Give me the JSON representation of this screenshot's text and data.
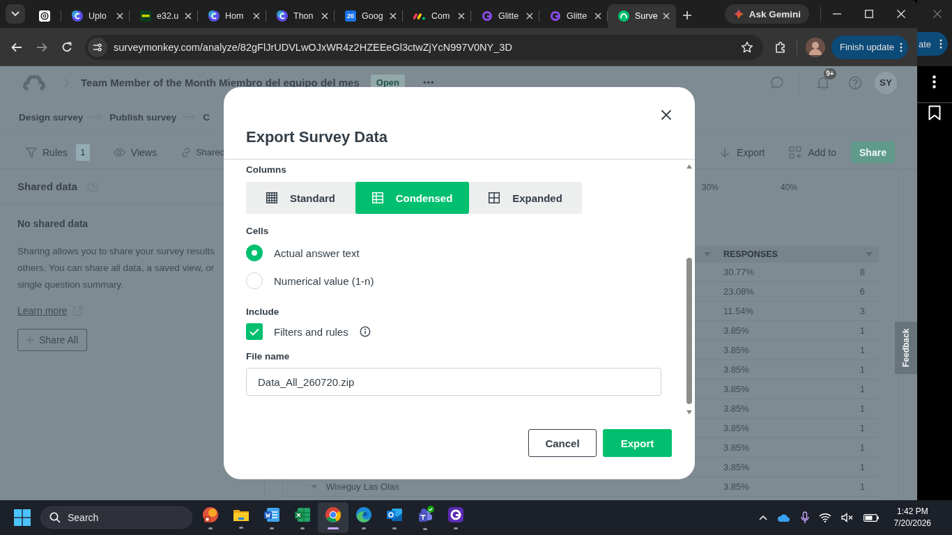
{
  "browser": {
    "tabs": [
      {
        "selected": false
      },
      {
        "label": "Uplo",
        "selected": false
      },
      {
        "label": "e32.u",
        "selected": false
      },
      {
        "label": "Hom",
        "selected": false
      },
      {
        "label": "Thon",
        "selected": false
      },
      {
        "label": "Goog",
        "icon_text": "20",
        "selected": false
      },
      {
        "label": "Com",
        "selected": false
      },
      {
        "label": "Glitte",
        "selected": false
      },
      {
        "label": "Glitte",
        "selected": false
      },
      {
        "label": "Surve",
        "selected": true
      }
    ],
    "url": "surveymonkey.com/analyze/82gFlJrUDVLwOJxWR4z2HZEEeGl3ctwZjYcN997V0NY_3D",
    "gemini_button": "Ask Gemini",
    "update_button": "Finish update"
  },
  "side_window": {
    "button": "ate"
  },
  "survey": {
    "title": "Team Member of the Month Miembro del equipo del mes",
    "status": "Open",
    "more": "•••",
    "notification_count": "9+",
    "avatar": "SY",
    "steps": [
      "Design survey",
      "Publish survey",
      "C"
    ],
    "toolbar_left": [
      {
        "label": "Rules",
        "badge": "1"
      },
      {
        "label": "Views"
      },
      {
        "label": "Shared"
      }
    ],
    "toolbar_right": [
      {
        "label": "Export"
      },
      {
        "label": "Add to"
      }
    ],
    "share_button": "Share",
    "shared_panel": {
      "title": "Shared data",
      "empty_title": "No shared data",
      "description_lines": [
        "Sharing allows you to share your survey results",
        "others. You can share all data, a saved view, or",
        "single question summary."
      ],
      "link": "Learn more",
      "button": "Share All"
    },
    "axis_labels": [
      "30%",
      "40%"
    ],
    "table": {
      "columns": [
        "RESPONSES"
      ],
      "rows": [
        {
          "percent": "30.77%",
          "count": "8"
        },
        {
          "percent": "23.08%",
          "count": "6"
        },
        {
          "percent": "11.54%",
          "count": "3"
        },
        {
          "percent": "3.85%",
          "count": "1"
        },
        {
          "percent": "3.85%",
          "count": "1"
        },
        {
          "percent": "3.85%",
          "count": "1"
        },
        {
          "percent": "3.85%",
          "count": "1"
        },
        {
          "percent": "3.85%",
          "count": "1"
        },
        {
          "percent": "3.85%",
          "count": "1"
        },
        {
          "percent": "3.85%",
          "count": "1"
        },
        {
          "percent": "3.85%",
          "count": "1"
        },
        {
          "answer": "Wiseguy Las Olas",
          "percent": "3.85%",
          "count": "1"
        }
      ]
    },
    "feedback": "Feedback"
  },
  "dialog": {
    "title": "Export Survey Data",
    "columns": {
      "label": "Columns",
      "options": [
        {
          "label": "Standard",
          "selected": false
        },
        {
          "label": "Condensed",
          "selected": true
        },
        {
          "label": "Expanded",
          "selected": false
        }
      ]
    },
    "cells": {
      "label": "Cells",
      "options": [
        {
          "label": "Actual answer text",
          "selected": true
        },
        {
          "label": "Numerical value (1-n)",
          "selected": false
        }
      ]
    },
    "include": {
      "label": "Include",
      "options": [
        {
          "label": "Filters and rules",
          "checked": true
        }
      ]
    },
    "file_name": {
      "label": "File name",
      "value": "Data_All_260720.zip"
    },
    "buttons": [
      {
        "label": "Cancel",
        "kind": "secondary"
      },
      {
        "label": "Export",
        "kind": "primary"
      }
    ]
  },
  "taskbar": {
    "search_placeholder": "Search",
    "apps": [
      {
        "selected": false
      },
      {
        "selected": false
      },
      {
        "selected": false
      },
      {
        "selected": false
      },
      {
        "selected": true
      },
      {
        "selected": false
      },
      {
        "selected": false
      },
      {
        "selected": false
      },
      {
        "selected": false
      }
    ],
    "time": "1:42 PM",
    "date": "7/20/2026"
  }
}
